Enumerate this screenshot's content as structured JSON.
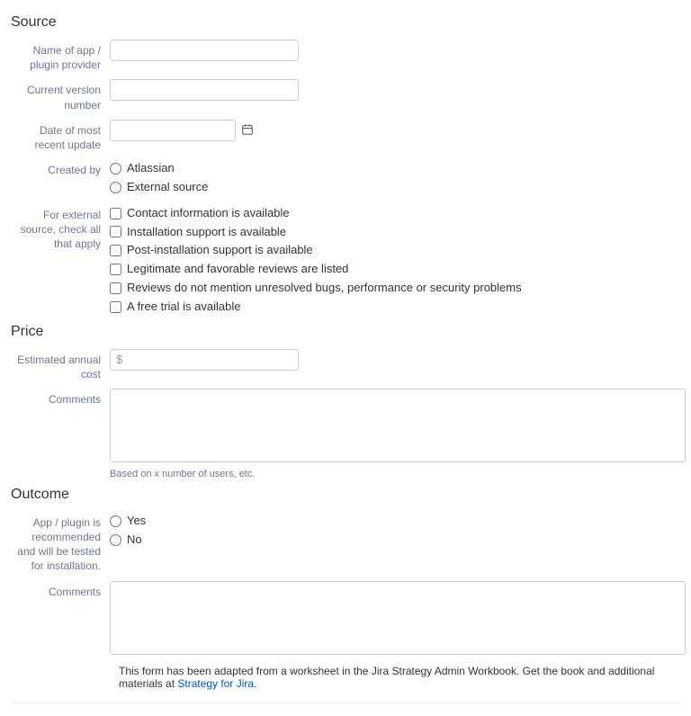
{
  "source": {
    "heading": "Source",
    "app_name_label": "Name of app / plugin provider",
    "version_label": "Current version number",
    "date_label": "Date of most recent update",
    "created_by_label": "Created by",
    "created_by_options": {
      "atlassian": "Atlassian",
      "external": "External source"
    },
    "external_checks_label": "For external source, check all that apply",
    "external_checks": {
      "contact": "Contact information is available",
      "install_support": "Installation support is available",
      "post_install_support": "Post-installation support is available",
      "reviews_listed": "Legitimate and favorable reviews are listed",
      "reviews_clean": "Reviews do not mention unresolved bugs, performance or security problems",
      "free_trial": "A free trial is available"
    }
  },
  "price": {
    "heading": "Price",
    "cost_label": "Estimated annual cost",
    "cost_placeholder": "$",
    "comments_label": "Comments",
    "comments_help": "Based on x number of users, etc."
  },
  "outcome": {
    "heading": "Outcome",
    "recommend_label": "App / plugin is recommended and will be tested for installation.",
    "options": {
      "yes": "Yes",
      "no": "No"
    },
    "comments_label": "Comments"
  },
  "footnote": {
    "text": "This form has been adapted from a worksheet in the Jira Strategy Admin Workbook. Get the book and additional materials at ",
    "link_text": "Strategy for Jira."
  }
}
